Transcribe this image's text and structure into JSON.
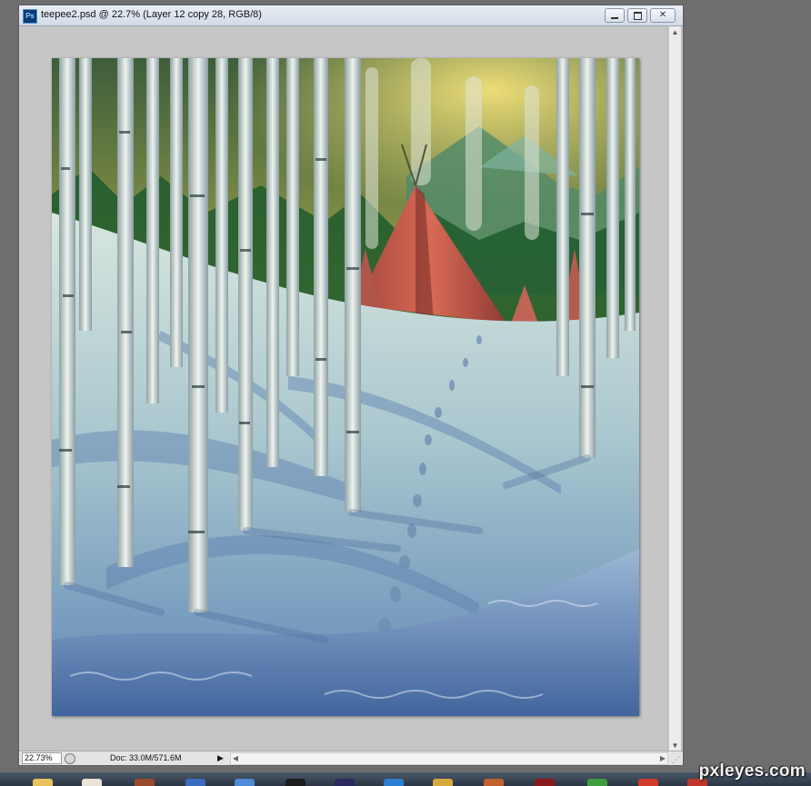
{
  "window": {
    "title": "teepee2.psd @ 22.7% (Layer 12 copy 28, RGB/8)",
    "app_icon_label": "Ps"
  },
  "status": {
    "zoom": "22.73%",
    "doc_info": "Doc: 33.0M/571.6M"
  },
  "watermark": "pxleyes.com",
  "taskbar": {
    "icons": [
      "folder-icon",
      "baseball-icon",
      "books-icon",
      "word-icon",
      "calculator-icon",
      "sphere-icon",
      "premiere-icon",
      "photoshop-icon",
      "winrar-icon",
      "audition-icon",
      "flash-icon",
      "messenger-icon",
      "firefox-icon",
      "opera-icon"
    ]
  }
}
